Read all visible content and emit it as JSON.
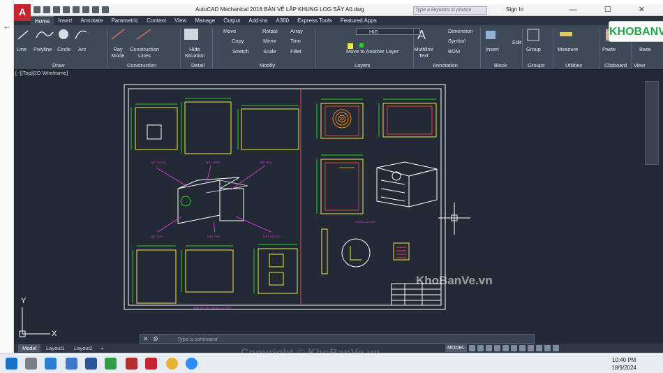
{
  "app": {
    "logo_letter": "A",
    "title": "AutoCAD Mechanical 2018     BẢN VẼ LẮP KHUNG LOG SẤY A0.dwg",
    "search_placeholder": "Type a keyword or phrase",
    "sign_in": "Sign In",
    "window_controls": "— ☐ ✕"
  },
  "tabs": [
    "Home",
    "Insert",
    "Annotate",
    "Parametric",
    "Content",
    "View",
    "Manage",
    "Output",
    "Add-ins",
    "A360",
    "Express Tools",
    "Featured Apps"
  ],
  "active_tab": "Home",
  "ribbon": {
    "draw": {
      "title": "Draw",
      "tools": [
        "Line",
        "Polyline",
        "Circle",
        "Arc"
      ]
    },
    "construction": {
      "title": "Construction",
      "tools": [
        "Ray Mode",
        "Construction Lines"
      ]
    },
    "detail": {
      "title": "Detail",
      "tools": [
        "Hide Situation"
      ]
    },
    "modify": {
      "title": "Modify",
      "tools": [
        "Move",
        "Rotate",
        "Array",
        "Copy",
        "Mirror",
        "Trim",
        "Stretch",
        "Scale",
        "Fillet"
      ],
      "move_to_layer": "Move to Another Layer"
    },
    "layers": {
      "title": "Layers",
      "current": "HID"
    },
    "annotation": {
      "title": "Annotation",
      "multiline": "Multiline Text",
      "dimension": "Dimension",
      "symbol": "Symbol",
      "bom": "BOM"
    },
    "block": {
      "title": "Block",
      "insert": "Insert",
      "edit": "Edit"
    },
    "groups": {
      "title": "Groups",
      "group": "Group"
    },
    "utilities": {
      "title": "Utilities",
      "measure": "Measure"
    },
    "clipboard": {
      "title": "Clipboard",
      "paste": "Paste"
    },
    "view": {
      "title": "View",
      "base": "Base"
    }
  },
  "viewport": {
    "label": "[−][Top][2D Wireframe]"
  },
  "drawing": {
    "view_labels": [
      "MẶT ĐỨNG",
      "MẶT TRÊN",
      "MẶT BÊN",
      "MẶT ĐÁY",
      "MẶT TRÁI",
      "MẶT TRƯỚC"
    ],
    "section_caption": "KHUNG LÒ SẤY",
    "footer_caption": "BẢN VẼ LẮP KHUNG LÒ SẤY"
  },
  "command": {
    "placeholder": "Type a command"
  },
  "layout_tabs": [
    "Model",
    "Layout1",
    "Layout2",
    "+"
  ],
  "statusbar": {
    "model": "MODEL"
  },
  "ucs": {
    "x": "X",
    "y": "Y"
  },
  "watermark": {
    "center": "KhoBanVe.vn",
    "bottom": "Copyright © KhoBanVe.vn",
    "logo": "KHOBANVE"
  },
  "taskbar": {
    "time": "10:40 PM",
    "date": "18/9/2024"
  },
  "colors": {
    "accent_red": "#c4262e",
    "bg": "#232a35",
    "frame": "#ffffff",
    "yellow": "#f2ea3c",
    "magenta": "#d335d3",
    "orange": "#f08a1c",
    "green": "#20a54a"
  }
}
